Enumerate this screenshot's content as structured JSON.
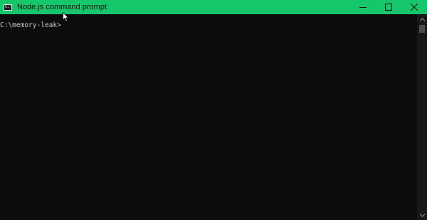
{
  "window": {
    "title": "Node.js command prompt",
    "icon": "cmd-icon",
    "icon_text": "C:\\",
    "controls": [
      "minimize-icon",
      "maximize-icon",
      "close-icon"
    ]
  },
  "console": {
    "prompt": "C:\\memory-leak>"
  },
  "colors": {
    "titlebar": "#15c66b",
    "console_background": "#0c0c0c",
    "console_text": "#cccccc"
  }
}
